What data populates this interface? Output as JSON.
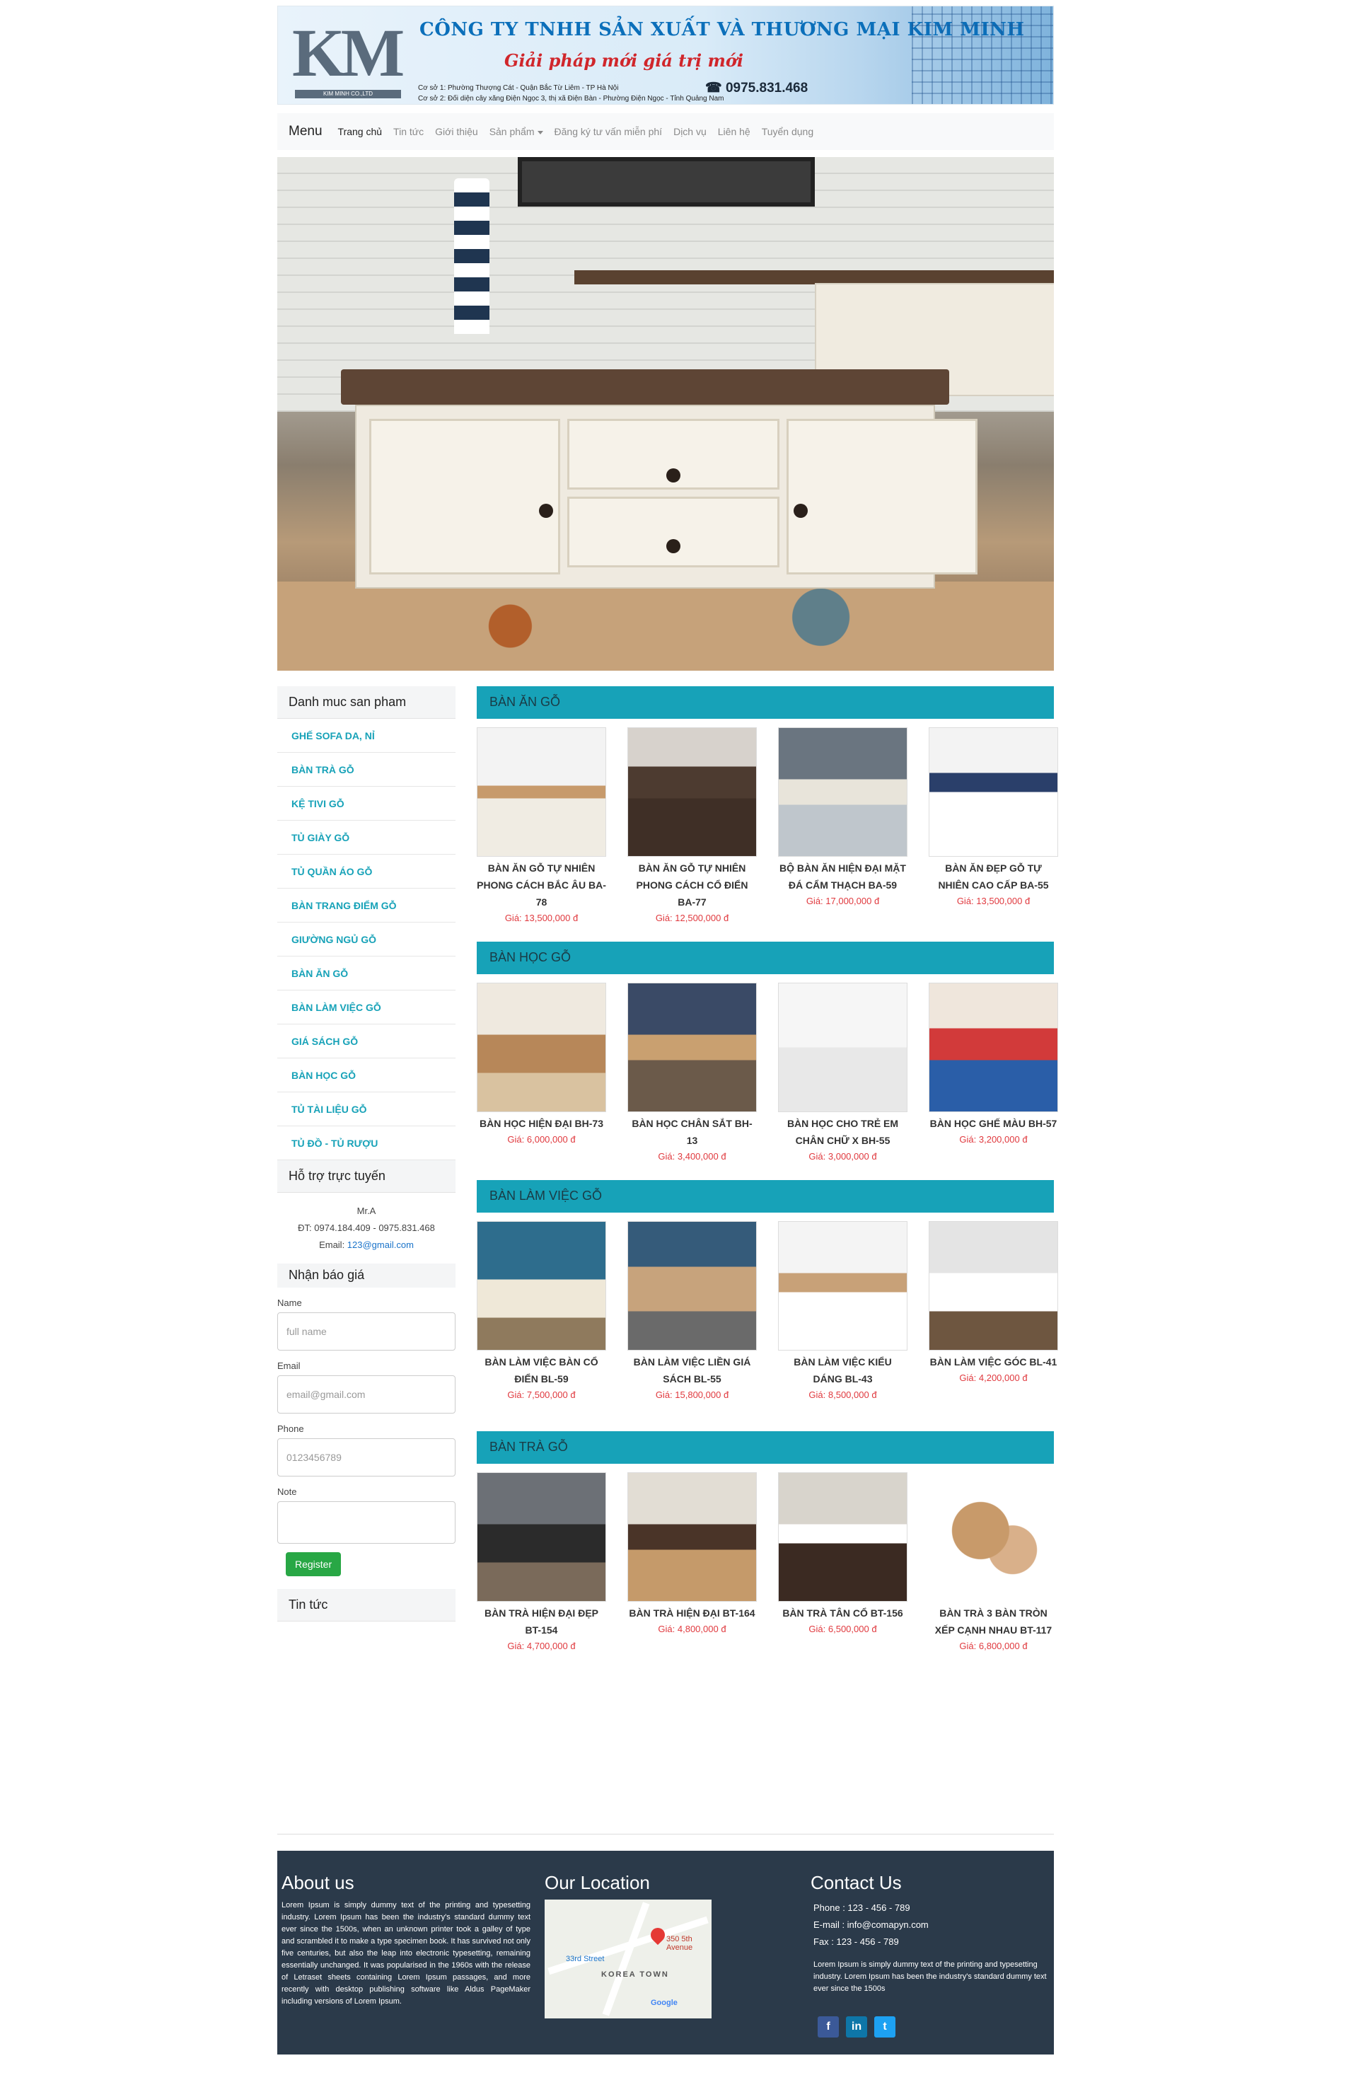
{
  "header": {
    "logo_text": "KM",
    "logo_small": "KIM MINH CO.,LTD",
    "company_name": "CÔNG TY TNHH SẢN XUẤT VÀ THƯƠNG MẠI KIM MINH",
    "slogan": "Giải pháp mới giá trị mới",
    "address1": "Cơ sở 1: Phường Thượng Cát - Quận Bắc Từ Liêm - TP Hà Nội",
    "address2": "Cơ sở 2: Đối diện cây xăng Điện Ngọc 3, thị xã Điện Bàn - Phường Điện Ngọc - Tỉnh Quảng Nam",
    "phone": "0975.831.468"
  },
  "nav": {
    "brand": "Menu",
    "items": [
      "Trang chủ",
      "Tin tức",
      "Giới thiệu",
      "Sản phẩm",
      "Đăng ký tư vấn miễn phí",
      "Dịch vụ",
      "Liên hệ",
      "Tuyển dụng"
    ]
  },
  "sidebar": {
    "categories_title": "Danh muc san pham",
    "categories": [
      "GHẾ SOFA DA, NỈ",
      "BÀN TRÀ GỖ",
      "KỆ TIVI GỖ",
      "TỦ GIÀY GỖ",
      "TỦ QUẦN ÁO GỖ",
      "BÀN TRANG ĐIỂM GỖ",
      "GIƯỜNG NGỦ GỖ",
      "BÀN ĂN GỖ",
      "BÀN LÀM VIỆC GỖ",
      "GIÁ SÁCH GỖ",
      "BÀN HỌC GỖ",
      "TỦ TÀI LIỆU GỖ",
      "TỦ ĐỒ - TỦ RƯỢU"
    ],
    "support_title": "Hỗ trợ trực tuyến",
    "support_name": "Mr.A",
    "support_phone": "ĐT: 0974.184.409 - 0975.831.468",
    "support_email_label": "Email: ",
    "support_email": "123@gmail.com",
    "form_title": "Nhận báo giá",
    "name_label": "Name",
    "name_placeholder": "full name",
    "email_label": "Email",
    "email_placeholder": "email@gmail.com",
    "phone_label": "Phone",
    "phone_placeholder": "0123456789",
    "note_label": "Note",
    "register_label": "Register",
    "news_title": "Tin tức"
  },
  "sections": [
    {
      "title": "BÀN ĂN GỖ",
      "products": [
        {
          "name": "BÀN ĂN GỖ TỰ NHIÊN PHONG CÁCH BẮC ÂU BA-78",
          "price": "Giá: 13,500,000 đ"
        },
        {
          "name": "BÀN ĂN GỖ TỰ NHIÊN PHONG CÁCH CỔ ĐIỂN BA-77",
          "price": "Giá: 12,500,000 đ"
        },
        {
          "name": "BỘ BÀN ĂN HIỆN ĐẠI MẶT ĐÁ CẨM THẠCH BA-59",
          "price": "Giá: 17,000,000 đ"
        },
        {
          "name": "BÀN ĂN ĐẸP GỖ TỰ NHIÊN CAO CẤP BA-55",
          "price": "Giá: 13,500,000 đ"
        }
      ]
    },
    {
      "title": "BÀN HỌC GỖ",
      "products": [
        {
          "name": "BÀN HỌC HIỆN ĐẠI BH-73",
          "price": "Giá: 6,000,000 đ"
        },
        {
          "name": "BÀN HỌC CHÂN SẮT BH-13",
          "price": "Giá: 3,400,000 đ"
        },
        {
          "name": "BÀN HỌC CHO TRẺ EM CHÂN CHỮ X BH-55",
          "price": "Giá: 3,000,000 đ"
        },
        {
          "name": "BÀN HỌC GHẾ MÀU BH-57",
          "price": "Giá: 3,200,000 đ"
        }
      ]
    },
    {
      "title": "BÀN LÀM VIỆC GỖ",
      "products": [
        {
          "name": "BÀN LÀM VIỆC BÀN CỔ ĐIỂN BL-59",
          "price": "Giá: 7,500,000 đ"
        },
        {
          "name": "BÀN LÀM VIỆC LIỀN GIÁ SÁCH BL-55",
          "price": "Giá: 15,800,000 đ"
        },
        {
          "name": "BÀN LÀM VIỆC KIỂU DÁNG BL-43",
          "price": "Giá: 8,500,000 đ"
        },
        {
          "name": "BÀN LÀM VIỆC GÓC BL-41",
          "price": "Giá: 4,200,000 đ"
        }
      ]
    },
    {
      "title": "BÀN TRÀ GỖ",
      "products": [
        {
          "name": "BÀN TRÀ HIỆN ĐẠI ĐẸP BT-154",
          "price": "Giá: 4,700,000 đ"
        },
        {
          "name": "BÀN TRÀ HIỆN ĐẠI BT-164",
          "price": "Giá: 4,800,000 đ"
        },
        {
          "name": "BÀN TRÀ TÂN CỔ BT-156",
          "price": "Giá: 6,500,000 đ"
        },
        {
          "name": "BÀN TRÀ 3 BÀN TRÒN XẾP CẠNH NHAU BT-117",
          "price": "Giá: 6,800,000 đ"
        }
      ]
    }
  ],
  "footer": {
    "about_title": "About us",
    "about_text": "Lorem Ipsum is simply dummy text of the printing and typesetting industry. Lorem Ipsum has been the industry's standard dummy text ever since the 1500s, when an unknown printer took a galley of type and scrambled it to make a type specimen book. It has survived not only five centuries, but also the leap into electronic typesetting, remaining essentially unchanged. It was popularised in the 1960s with the release of Letraset sheets containing Lorem Ipsum passages, and more recently with desktop publishing software like Aldus PageMaker including versions of Lorem Ipsum.",
    "location_title": "Our Location",
    "map_label_1": "350 5th Avenue",
    "map_label_2": "KOREA TOWN",
    "map_label_3": "33rd Street",
    "map_label_4": "Google",
    "contact_title": "Contact Us",
    "phone": "Phone : 123 - 456 - 789",
    "email": "E-mail : info@comapyn.com",
    "fax": "Fax : 123 - 456 - 789",
    "contact_text": "Lorem Ipsum is simply dummy text of the printing and typesetting industry. Lorem Ipsum has been the industry's standard dummy text ever since the 1500s",
    "social": [
      "facebook-icon",
      "linkedin-icon",
      "twitter-icon"
    ]
  },
  "colors": {
    "accent": "#17a2b8",
    "price": "#e0393e",
    "footer": "#2b3a4a",
    "register": "#28a745"
  }
}
